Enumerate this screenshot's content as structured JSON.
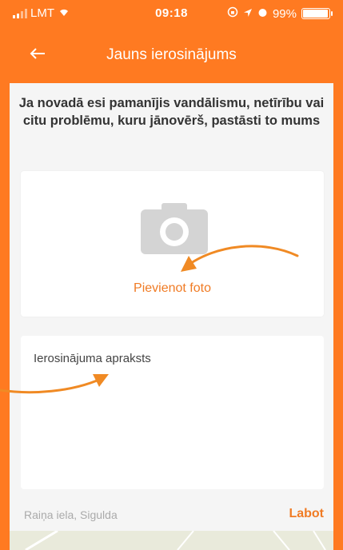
{
  "statusbar": {
    "carrier": "LMT",
    "time": "09:18",
    "battery": "99%",
    "battery_level": 0.99
  },
  "header": {
    "title": "Jauns ierosinājums"
  },
  "intro": {
    "text": "Ja novadā esi pamanījis vandālismu, netīrību vai citu problēmu, kuru jānovērš, pastāsti to mums"
  },
  "photo": {
    "label": "Pievienot foto"
  },
  "description": {
    "placeholder": "Ierosinājuma apraksts"
  },
  "location": {
    "address": "Raiņa iela, Sigulda",
    "edit_label": "Labot"
  },
  "colors": {
    "accent": "#ff7a21",
    "annotation_arrow": "#f08a24"
  }
}
